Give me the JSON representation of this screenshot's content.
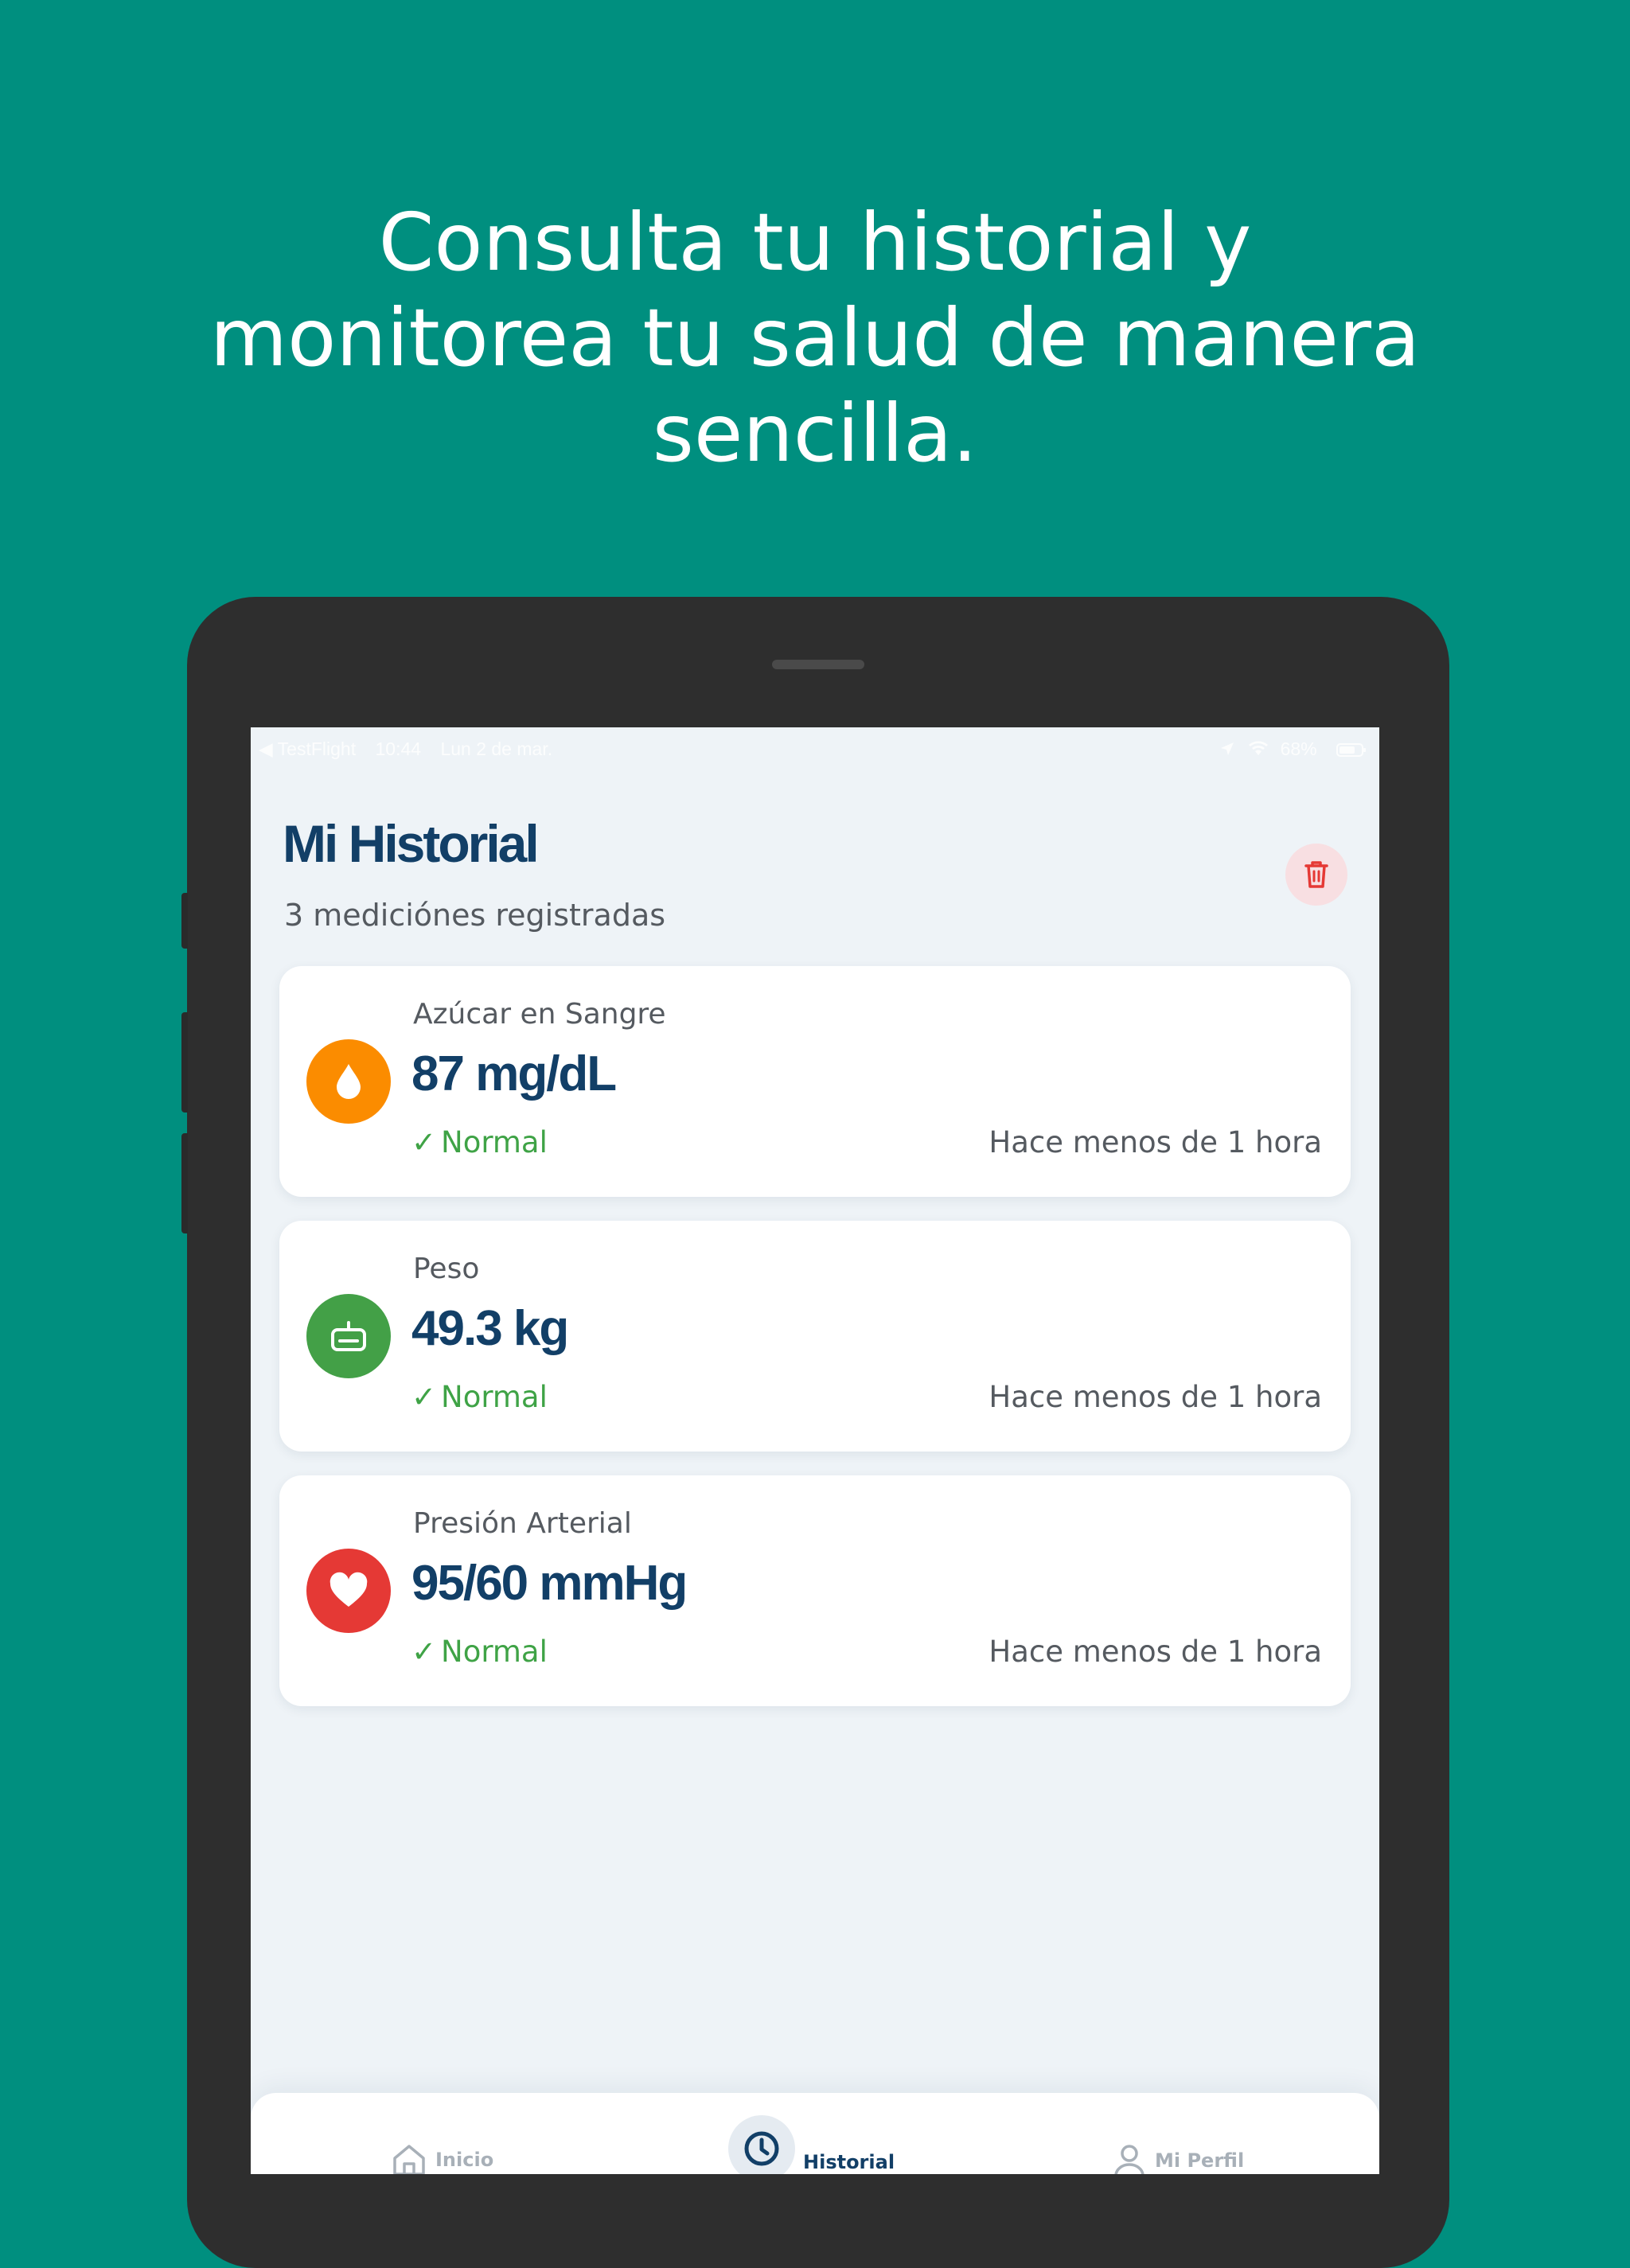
{
  "headline": {
    "line1": "Consulta tu historial y",
    "line2": "monitorea tu salud de manera",
    "line3": "sencilla."
  },
  "statusbar": {
    "back_app": "◀ TestFlight",
    "time": "10:44",
    "date": "Lun 2 de mar.",
    "battery": "68%"
  },
  "header": {
    "title": "Mi Historial",
    "subtitle": "3 mediciónes registradas"
  },
  "measurements": [
    {
      "label": "Azúcar en Sangre",
      "value": "87 mg/dL",
      "status": "Normal",
      "time": "Hace menos de 1 hora",
      "icon": "drop-icon",
      "color": "#fb8c00"
    },
    {
      "label": "Peso",
      "value": "49.3 kg",
      "status": "Normal",
      "time": "Hace menos de 1 hora",
      "icon": "scale-icon",
      "color": "#43a047"
    },
    {
      "label": "Presión Arterial",
      "value": "95/60 mmHg",
      "status": "Normal",
      "time": "Hace menos de 1 hora",
      "icon": "heart-icon",
      "color": "#e53935"
    }
  ],
  "tabs": {
    "home": "Inicio",
    "history": "Historial",
    "profile": "Mi Perfil"
  },
  "colors": {
    "background": "#008f7f",
    "primary": "#123f67",
    "success": "#3fa346",
    "danger": "#e53935"
  }
}
